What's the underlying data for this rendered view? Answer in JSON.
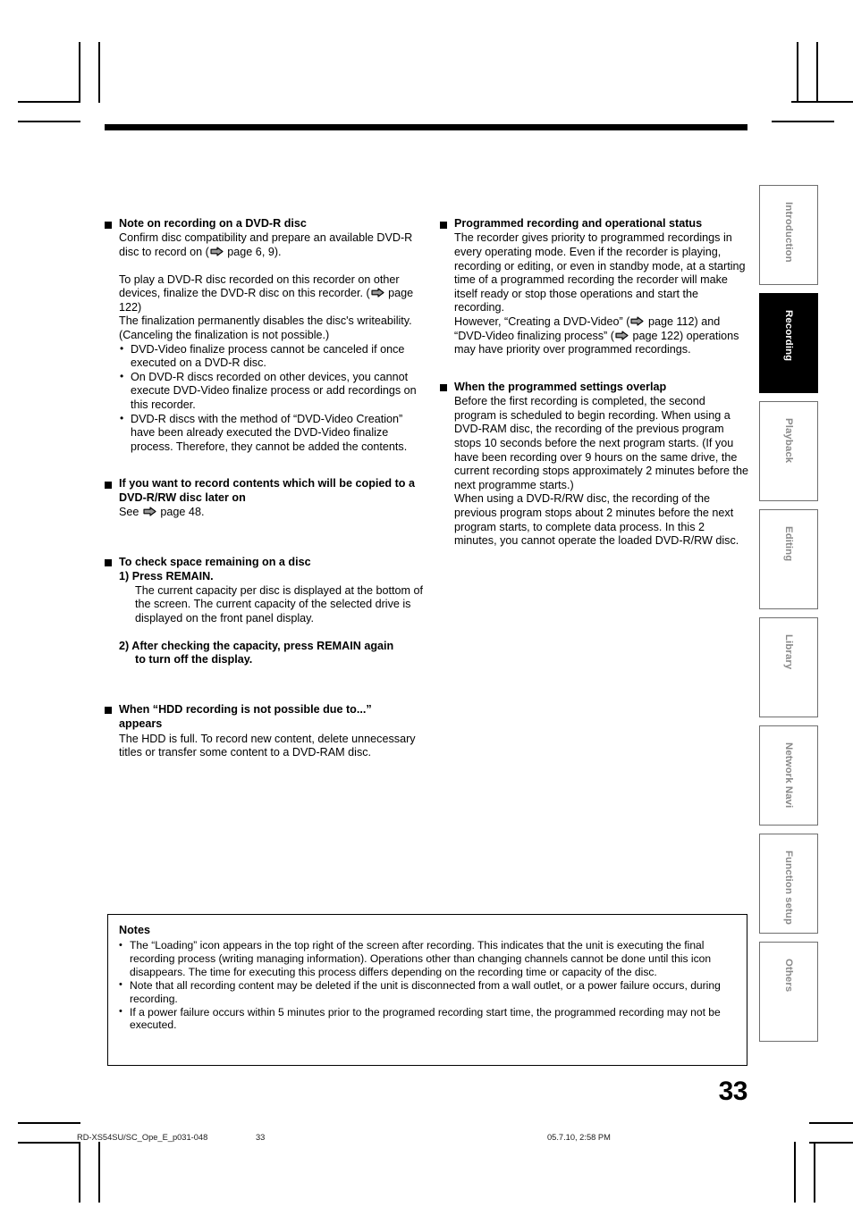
{
  "page": {
    "number": "33",
    "footer_file": "RD-XS54SU/SC_Ope_E_p031-048",
    "footer_page": "33",
    "footer_date": "05.7.10, 2:58 PM"
  },
  "side_tabs": [
    {
      "label": "Introduction",
      "active": false
    },
    {
      "label": "Recording",
      "active": true
    },
    {
      "label": "Playback",
      "active": false
    },
    {
      "label": "Editing",
      "active": false
    },
    {
      "label": "Library",
      "active": false
    },
    {
      "label": "Network Navi",
      "active": false
    },
    {
      "label": "Function setup",
      "active": false
    },
    {
      "label": "Others",
      "active": false
    }
  ],
  "left_column": {
    "s1": {
      "heading": "Note on recording on a DVD-R disc",
      "p1_a": "Confirm disc compatibility and prepare an available DVD-R disc to record on (",
      "p1_b": " page 6, 9).",
      "p2_a": "To play a DVD-R disc recorded on this recorder on other devices, finalize the DVD-R disc on this recorder. (",
      "p2_b": " page 122)",
      "p3": "The finalization permanently disables the disc's writeability. (Canceling the finalization is not possible.)",
      "bullets": [
        "DVD-Video finalize process cannot be canceled if once executed on a DVD-R disc.",
        "On DVD-R discs recorded on other devices, you cannot execute DVD-Video finalize process or add recordings on this recorder.",
        "DVD-R discs with the method of “DVD-Video Creation” have been already executed the DVD-Video finalize process. Therefore, they cannot be added the contents."
      ]
    },
    "s2": {
      "heading": "If you want to record contents which will be copied to a DVD-R/RW disc later on",
      "p1_a": "See ",
      "p1_b": " page 48."
    },
    "s3": {
      "heading": "To check space remaining on a disc",
      "step1": "1) Press REMAIN.",
      "step1_body": "The current capacity per disc is displayed at the bottom of the screen. The current capacity of the selected drive is displayed on the front panel display.",
      "step2": "2) After checking the capacity, press REMAIN again",
      "step2_cont": "to turn off the display."
    },
    "s4": {
      "heading": "When “HDD recording is not possible due to...”",
      "heading_cont": "appears",
      "p1": "The HDD is full. To record new content, delete unnecessary titles or transfer some content to a DVD-RAM disc."
    }
  },
  "right_column": {
    "s1": {
      "heading": "Programmed recording and operational status",
      "p1": "The recorder gives priority to programmed recordings in every operating mode. Even if the recorder is playing, recording or editing, or even in standby mode, at a starting time of a programmed recording the recorder will make itself ready or stop those operations and start the recording.",
      "p2_a": "However, “Creating a DVD-Video” (",
      "p2_b": " page 112) and “DVD-Video finalizing process” (",
      "p2_c": " page 122) operations may have priority over programmed recordings."
    },
    "s2": {
      "heading": "When the programmed settings overlap",
      "p1": "Before the first recording is completed, the second program is scheduled to begin recording. When using a DVD-RAM disc, the recording of the previous program stops 10 seconds before the next program starts. (If you have been recording over 9 hours on the same drive, the current recording stops approximately 2 minutes before the next programme starts.)",
      "p2": "When using a DVD-R/RW disc, the recording of the previous program stops about 2 minutes before the next program starts, to complete data process. In this 2 minutes, you cannot operate the loaded DVD-R/RW disc."
    }
  },
  "notes": {
    "title": "Notes",
    "items": [
      "The “Loading” icon appears in the top right of the screen after recording. This indicates that the unit is executing the final recording process (writing managing information). Operations other than changing channels cannot be done until this icon disappears. The time for executing this process differs depending on the recording time or capacity of the disc.",
      "Note that all recording content may be deleted if the unit is disconnected from a wall outlet, or a power failure occurs, during recording.",
      "If a power failure occurs within 5 minutes prior to the programed recording start time, the programmed recording may not be executed."
    ]
  },
  "icons": {
    "page_arrow": "arrow-right-icon"
  },
  "colors": {
    "active_tab_bg": "#000000",
    "tab_border": "#6e6e6e",
    "tab_text": "#8a8a8a",
    "arrow_fill": "#9a9a9a"
  }
}
